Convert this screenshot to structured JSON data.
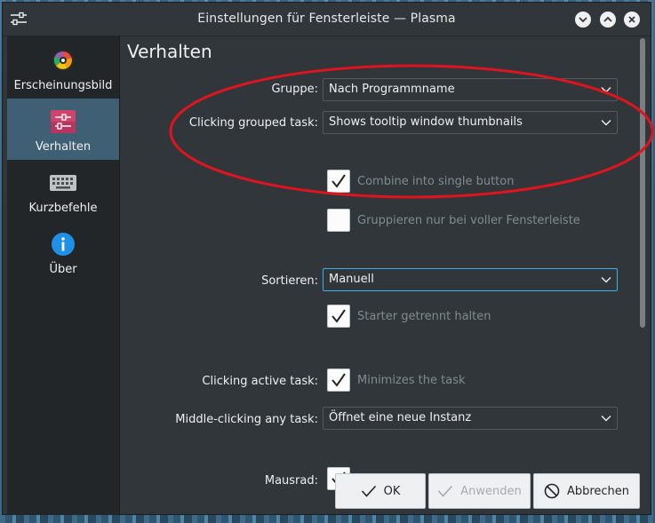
{
  "window": {
    "title": "Einstellungen für Fensterleiste — Plasma"
  },
  "sidebar": {
    "items": [
      {
        "label": "Erscheinungsbild",
        "icon": "color-wheel-icon",
        "active": false
      },
      {
        "label": "Verhalten",
        "icon": "sliders-icon",
        "active": true
      },
      {
        "label": "Kurzbefehle",
        "icon": "keyboard-icon",
        "active": false
      },
      {
        "label": "Über",
        "icon": "info-icon",
        "active": false
      }
    ]
  },
  "main": {
    "title": "Verhalten",
    "group": {
      "label": "Gruppe:",
      "value": "Nach Programmname"
    },
    "grouped_click": {
      "label": "Clicking grouped task:",
      "value": "Shows tooltip window thumbnails"
    },
    "combine": {
      "label": "Combine into single button",
      "checked": true
    },
    "group_full": {
      "label": "Gruppieren nur bei voller Fensterleiste",
      "checked": false
    },
    "sort": {
      "label": "Sortieren:",
      "value": "Manuell"
    },
    "launchers_separate": {
      "label": "Starter getrennt halten",
      "checked": true
    },
    "active_click": {
      "label": "Clicking active task:",
      "text": "Minimizes the task",
      "checked": true
    },
    "middle_click": {
      "label": "Middle-clicking any task:",
      "value": "Öffnet eine neue Instanz"
    },
    "mousewheel": {
      "label": "Mausrad:"
    }
  },
  "footer": {
    "ok": "OK",
    "apply": "Anwenden",
    "cancel": "Abbrechen"
  },
  "colors": {
    "accent": "#3daee9",
    "annotation": "#e0141e"
  }
}
